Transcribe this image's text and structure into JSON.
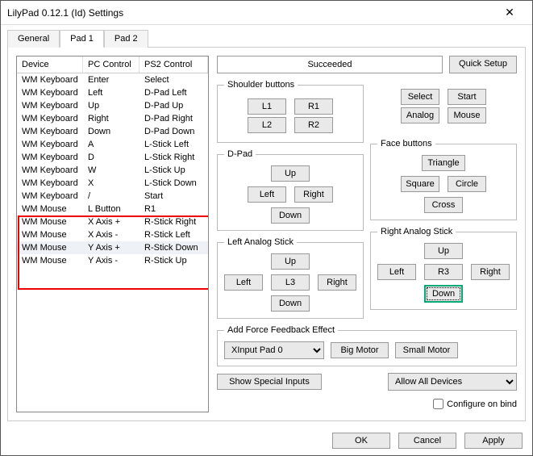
{
  "title": "LilyPad 0.12.1 (Id) Settings",
  "tabs": {
    "general": "General",
    "pad1": "Pad 1",
    "pad2": "Pad 2"
  },
  "headers": {
    "device": "Device",
    "pc": "PC Control",
    "ps2": "PS2 Control"
  },
  "rows": [
    {
      "d": "WM Keyboard",
      "pc": "Enter",
      "ps2": "Select"
    },
    {
      "d": "WM Keyboard",
      "pc": "Left",
      "ps2": "D-Pad Left"
    },
    {
      "d": "WM Keyboard",
      "pc": "Up",
      "ps2": "D-Pad Up"
    },
    {
      "d": "WM Keyboard",
      "pc": "Right",
      "ps2": "D-Pad Right"
    },
    {
      "d": "WM Keyboard",
      "pc": "Down",
      "ps2": "D-Pad Down"
    },
    {
      "d": "WM Keyboard",
      "pc": "A",
      "ps2": "L-Stick Left"
    },
    {
      "d": "WM Keyboard",
      "pc": "D",
      "ps2": "L-Stick Right"
    },
    {
      "d": "WM Keyboard",
      "pc": "W",
      "ps2": "L-Stick Up"
    },
    {
      "d": "WM Keyboard",
      "pc": "X",
      "ps2": "L-Stick Down"
    },
    {
      "d": "WM Keyboard",
      "pc": "/",
      "ps2": "Start"
    },
    {
      "d": "WM Mouse",
      "pc": "L Button",
      "ps2": "R1"
    },
    {
      "d": "WM Mouse",
      "pc": "X Axis +",
      "ps2": "R-Stick Right"
    },
    {
      "d": "WM Mouse",
      "pc": "X Axis -",
      "ps2": "R-Stick Left"
    },
    {
      "d": "WM Mouse",
      "pc": "Y Axis +",
      "ps2": "R-Stick Down"
    },
    {
      "d": "WM Mouse",
      "pc": "Y Axis -",
      "ps2": "R-Stick Up"
    }
  ],
  "status": "Succeeded",
  "quickSetup": "Quick Setup",
  "grp": {
    "shoulder": "Shoulder buttons",
    "dpad": "D-Pad",
    "lstick": "Left Analog Stick",
    "face": "Face buttons",
    "rstick": "Right Analog Stick",
    "ff": "Add Force Feedback Effect"
  },
  "btns": {
    "L1": "L1",
    "L2": "L2",
    "R1": "R1",
    "R2": "R2",
    "select": "Select",
    "start": "Start",
    "analog": "Analog",
    "mouse": "Mouse",
    "up": "Up",
    "down": "Down",
    "left": "Left",
    "right": "Right",
    "triangle": "Triangle",
    "square": "Square",
    "circle": "Circle",
    "cross": "Cross",
    "L3": "L3",
    "R3": "R3",
    "big": "Big Motor",
    "small": "Small Motor",
    "special": "Show Special Inputs"
  },
  "ffSelect": "XInput Pad 0",
  "allowSelect": "Allow All Devices",
  "configure": "Configure on bind",
  "dlg": {
    "ok": "OK",
    "cancel": "Cancel",
    "apply": "Apply"
  }
}
